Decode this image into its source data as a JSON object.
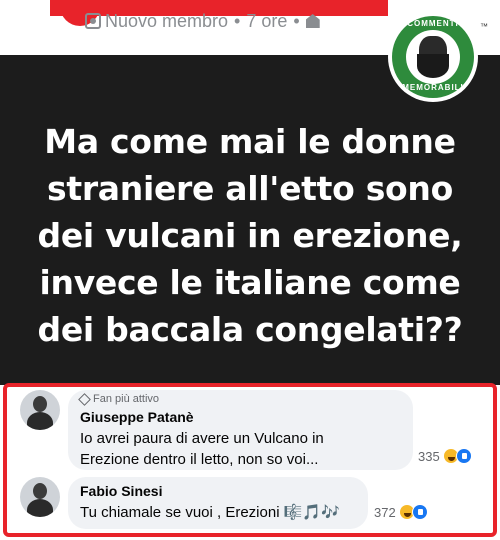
{
  "post_header": {
    "role_label": "Nuovo membro",
    "separator": "•",
    "time": "7 ore"
  },
  "post_image": {
    "lines": [
      "Ma come mai le donne",
      "straniere all'etto sono",
      "dei vulcani in erezione,",
      "invece le italiane come",
      "dei baccala congelati??"
    ]
  },
  "badge": {
    "top_text": "COMMENTI",
    "bottom_text": "MEMORABILI",
    "trademark": "™"
  },
  "comments": [
    {
      "tag": "Fan più attivo",
      "author": "Giuseppe Patanè",
      "text_lines": [
        "Io avrei paura di avere un Vulcano in",
        "Erezione dentro il letto, non so voi..."
      ],
      "reaction_count": "335"
    },
    {
      "tag": "",
      "author": "Fabio Sinesi",
      "text_lines": [
        "Tu chiamale se vuoi , Erezioni 🎼🎵🎶"
      ],
      "reaction_count": "372"
    }
  ],
  "colors": {
    "accent_red": "#e8232a",
    "image_bg": "#1c1c1c",
    "badge_green": "#2e8b3c",
    "bubble_bg": "#f0f2f5"
  }
}
